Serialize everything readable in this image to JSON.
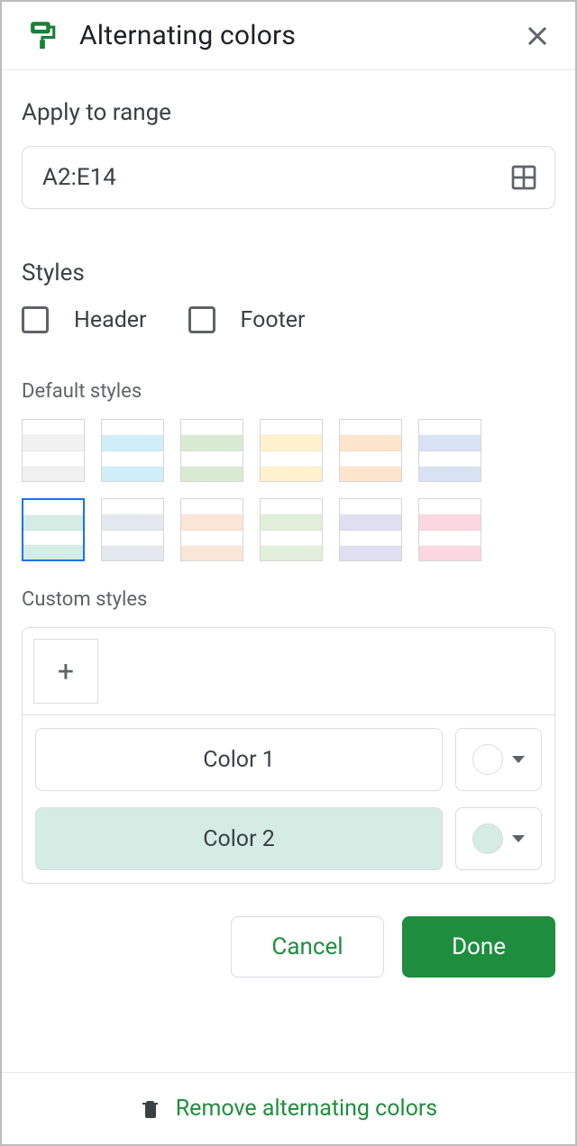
{
  "header": {
    "title": "Alternating colors"
  },
  "range": {
    "label": "Apply to range",
    "value": "A2:E14"
  },
  "styles": {
    "label": "Styles",
    "header_label": "Header",
    "footer_label": "Footer",
    "default_label": "Default styles",
    "custom_label": "Custom styles",
    "default_swatches": [
      {
        "c1": "#ffffff",
        "c2": "#f1f1f1",
        "c3": "#ffffff",
        "c4": "#f1f1f1",
        "selected": false
      },
      {
        "c1": "#ffffff",
        "c2": "#d0eef7",
        "c3": "#ffffff",
        "c4": "#d0eef7",
        "selected": false
      },
      {
        "c1": "#ffffff",
        "c2": "#d9ead3",
        "c3": "#ffffff",
        "c4": "#d9ead3",
        "selected": false
      },
      {
        "c1": "#ffffff",
        "c2": "#fff2cc",
        "c3": "#ffffff",
        "c4": "#fff2cc",
        "selected": false
      },
      {
        "c1": "#ffffff",
        "c2": "#fce5cd",
        "c3": "#ffffff",
        "c4": "#fce5cd",
        "selected": false
      },
      {
        "c1": "#ffffff",
        "c2": "#d9e2f3",
        "c3": "#ffffff",
        "c4": "#d9e2f3",
        "selected": false
      },
      {
        "c1": "#ffffff",
        "c2": "#d4ece4",
        "c3": "#ffffff",
        "c4": "#d4ece4",
        "selected": true
      },
      {
        "c1": "#ffffff",
        "c2": "#e2e8ed",
        "c3": "#ffffff",
        "c4": "#e2e8ed",
        "selected": false
      },
      {
        "c1": "#ffffff",
        "c2": "#fbe5d6",
        "c3": "#ffffff",
        "c4": "#fbe5d6",
        "selected": false
      },
      {
        "c1": "#ffffff",
        "c2": "#e2efda",
        "c3": "#ffffff",
        "c4": "#e2efda",
        "selected": false
      },
      {
        "c1": "#ffffff",
        "c2": "#e0dff2",
        "c3": "#ffffff",
        "c4": "#e0dff2",
        "selected": false
      },
      {
        "c1": "#ffffff",
        "c2": "#fbd7e1",
        "c3": "#ffffff",
        "c4": "#fbd7e1",
        "selected": false
      }
    ],
    "color1_label": "Color 1",
    "color2_label": "Color 2",
    "color1_value": "#ffffff",
    "color2_value": "#d4ece4"
  },
  "buttons": {
    "cancel": "Cancel",
    "done": "Done"
  },
  "footer": {
    "remove": "Remove alternating colors"
  }
}
